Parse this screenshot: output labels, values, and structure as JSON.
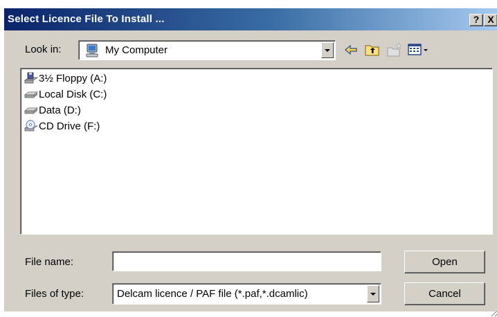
{
  "window": {
    "title": "Select Licence File To Install ...",
    "help_label": "?",
    "close_label": "X",
    "title_gradient": [
      "#0a246a",
      "#a6caf0"
    ],
    "face_color": "#d4d0c8"
  },
  "lookin": {
    "label": "Look in:",
    "value": "My Computer",
    "icon": "my-computer-icon"
  },
  "toolbar": {
    "back_icon": "back-arrow-icon",
    "up_icon": "up-folder-icon",
    "new_folder_icon": "new-folder-icon",
    "views_icon": "view-menu-icon"
  },
  "files": [
    {
      "label": "3½ Floppy (A:)",
      "icon": "floppy-drive-icon"
    },
    {
      "label": "Local Disk (C:)",
      "icon": "hard-disk-icon"
    },
    {
      "label": "Data (D:)",
      "icon": "hard-disk-icon"
    },
    {
      "label": "CD Drive (F:)",
      "icon": "cd-drive-icon"
    }
  ],
  "filename": {
    "label": "File name:",
    "value": ""
  },
  "filetype": {
    "label": "Files of type:",
    "value": "Delcam licence / PAF file (*.paf,*.dcamlic)"
  },
  "buttons": {
    "open": "Open",
    "cancel": "Cancel"
  }
}
